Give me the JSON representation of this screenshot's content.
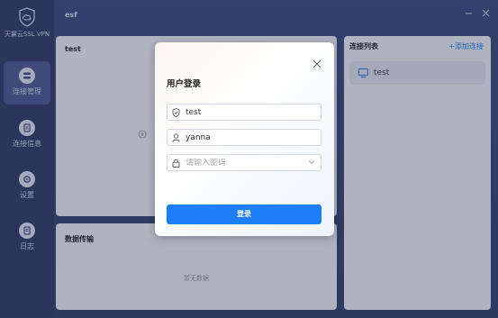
{
  "app": {
    "logo_text": "天翼云SSL VPN",
    "header_title": "esf"
  },
  "sidebar": {
    "items": [
      {
        "label": "连接管理",
        "icon": "connection-icon",
        "active": true
      },
      {
        "label": "连接信息",
        "icon": "info-icon",
        "active": false
      },
      {
        "label": "设置",
        "icon": "settings-icon",
        "active": false
      },
      {
        "label": "日志",
        "icon": "log-icon",
        "active": false
      }
    ]
  },
  "main_panel": {
    "title": "test"
  },
  "connection_list": {
    "title": "连接列表",
    "add_label": "+添加连接",
    "items": [
      {
        "name": "test"
      }
    ]
  },
  "transfer_panel": {
    "title": "数据传输",
    "empty_text": "暂无数据"
  },
  "login_dialog": {
    "title": "用户登录",
    "connection_value": "test",
    "username_value": "yanna",
    "password_placeholder": "请输入密码",
    "login_label": "登录"
  },
  "colors": {
    "accent": "#1e7ef5",
    "sidebar_bg": "#2f3a64",
    "app_bg": "#34406d"
  }
}
